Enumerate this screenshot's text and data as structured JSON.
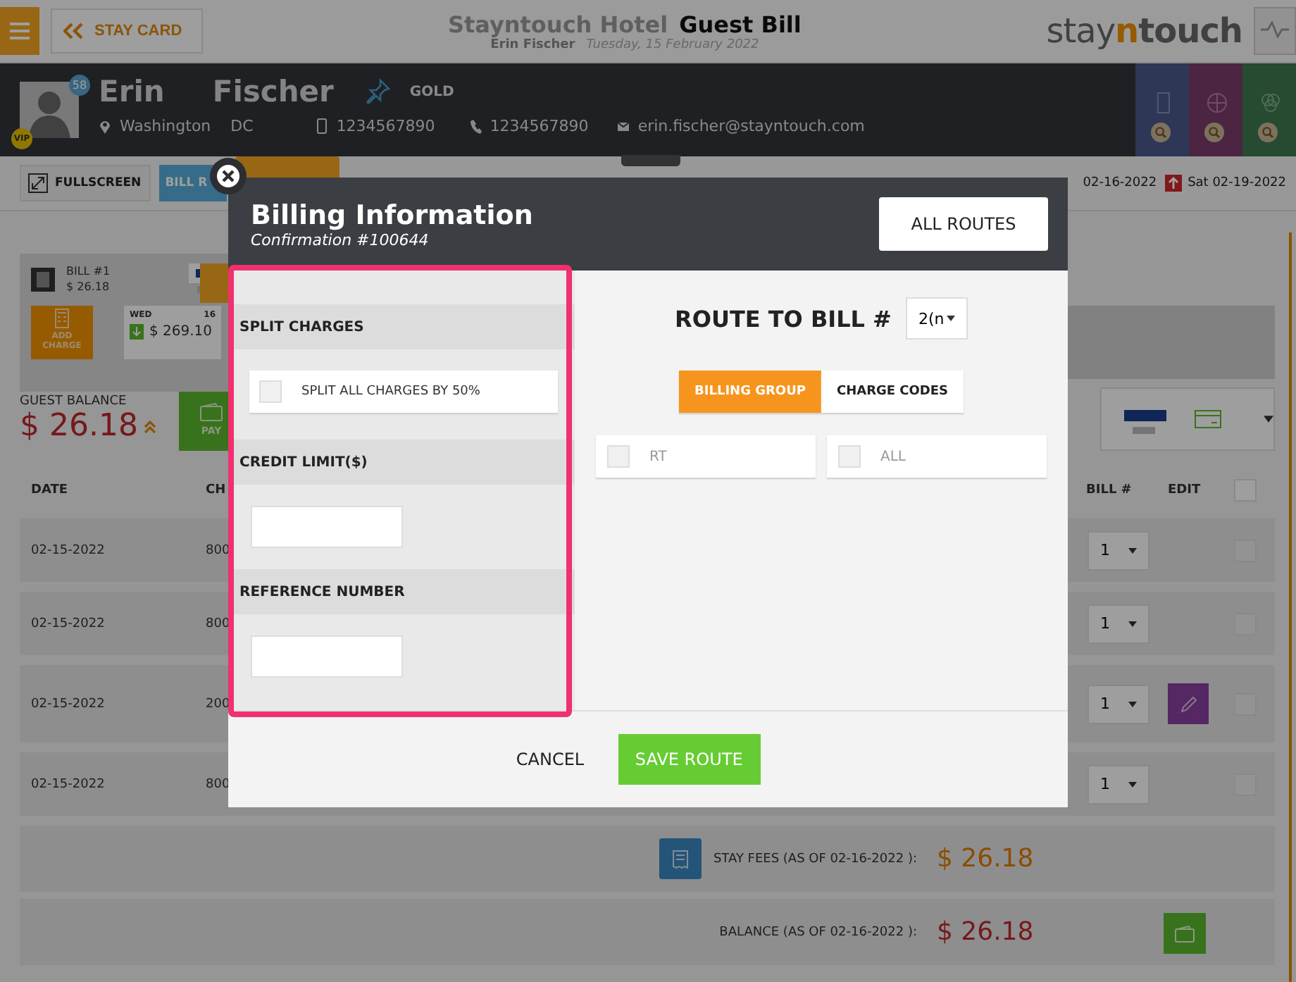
{
  "header": {
    "back_button": "STAY CARD",
    "hotel": "Stayntouch Hotel",
    "title": "Guest Bill",
    "guest_name": "Erin Fischer",
    "date": "Tuesday, 15 February 2022",
    "logo": [
      "stay",
      "n",
      "touch"
    ]
  },
  "guest": {
    "first_name": "Erin",
    "last_name": "Fischer",
    "count_badge": "58",
    "vip_badge": "VIP",
    "membership": "GOLD",
    "city": "Washington",
    "state": "DC",
    "mobile": "1234567890",
    "phone": "1234567890",
    "email": "erin.fischer@stayntouch.com"
  },
  "toolbar": {
    "buttons": [
      {
        "kind": "fullscreen",
        "label": "FULLSCREEN"
      },
      {
        "kind": "bill",
        "label": "BILL R"
      }
    ],
    "dates": [
      {
        "kind": "arrival",
        "text": "02-16-2022"
      },
      {
        "kind": "departure",
        "text": "Sat 02-19-2022"
      }
    ]
  },
  "bill_card": {
    "title": "BILL #1",
    "amount": "$ 26.18",
    "add_charge": "ADD CHARGE",
    "day": "WED",
    "day_number": "16",
    "day_amount": "$ 269.10"
  },
  "balance": {
    "label": "GUEST BALANCE",
    "amount": "$ 26.18",
    "pay": "PAY"
  },
  "table": {
    "columns": [
      "DATE",
      "CH",
      "BILL #",
      "EDIT"
    ],
    "select_all": {
      "checked": false
    },
    "rows": [
      {
        "date": "02-15-2022",
        "column_2": "800",
        "bill": "1",
        "edit": false,
        "checked": false
      },
      {
        "date": "02-15-2022",
        "column_2": "800",
        "bill": "1",
        "edit": false,
        "checked": false
      },
      {
        "date": "02-15-2022",
        "column_2": "200",
        "bill": "1",
        "edit": true,
        "checked": false
      },
      {
        "date": "02-15-2022",
        "column_2": "800",
        "bill": "1",
        "edit": false,
        "checked": false
      }
    ]
  },
  "totals": [
    {
      "kind": "fees",
      "label": "STAY FEES (AS OF 02-16-2022 ):",
      "amount": "$ 26.18"
    },
    {
      "kind": "balance",
      "label": "BALANCE (AS OF 02-16-2022 ):",
      "amount": "$ 26.18"
    }
  ],
  "modal": {
    "title": "Billing Information",
    "subtitle": "Confirmation #100644",
    "all_routes": "ALL ROUTES",
    "split_header": "SPLIT CHARGES",
    "split_option": {
      "label": "SPLIT ALL CHARGES BY 50%",
      "checked": false
    },
    "credit_header": "CREDIT LIMIT($)",
    "reference_header": "REFERENCE NUMBER",
    "route_label": "ROUTE TO BILL #",
    "route_value": "2(n",
    "tabs": [
      {
        "label": "BILLING GROUP",
        "selected": true
      },
      {
        "label": "CHARGE CODES",
        "selected": false
      }
    ],
    "options": [
      {
        "label": "RT",
        "checked": false
      },
      {
        "label": "ALL",
        "checked": false
      }
    ],
    "cancel": "CANCEL",
    "save": "SAVE ROUTE"
  }
}
